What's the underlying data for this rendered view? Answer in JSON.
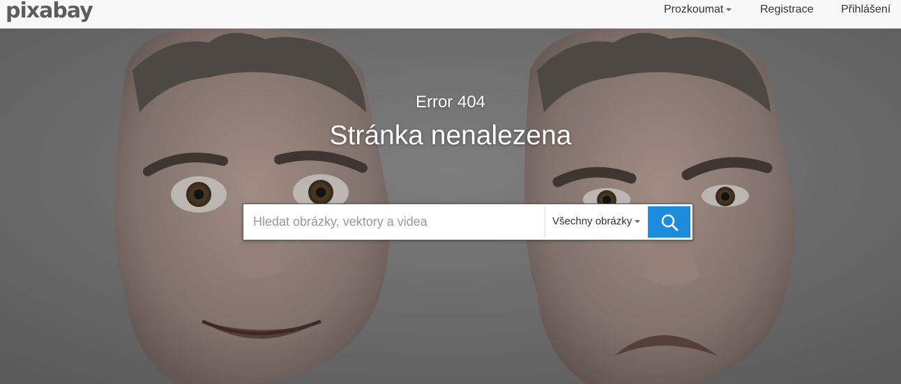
{
  "header": {
    "logo_text": "pixabay",
    "nav": {
      "explore_label": "Prozkoumat",
      "register_label": "Registrace",
      "login_label": "Přihlášení"
    }
  },
  "hero": {
    "error_code": "Error 404",
    "title": "Stránka nenalezena"
  },
  "search": {
    "placeholder": "Hledat obrázky, vektory a videa",
    "value": "",
    "type_selected": "Všechny obrázky",
    "button_icon": "search-icon"
  },
  "colors": {
    "accent": "#1b8ddc",
    "topbar_bg": "#f8f8f8",
    "logo": "#5c5c5c"
  }
}
